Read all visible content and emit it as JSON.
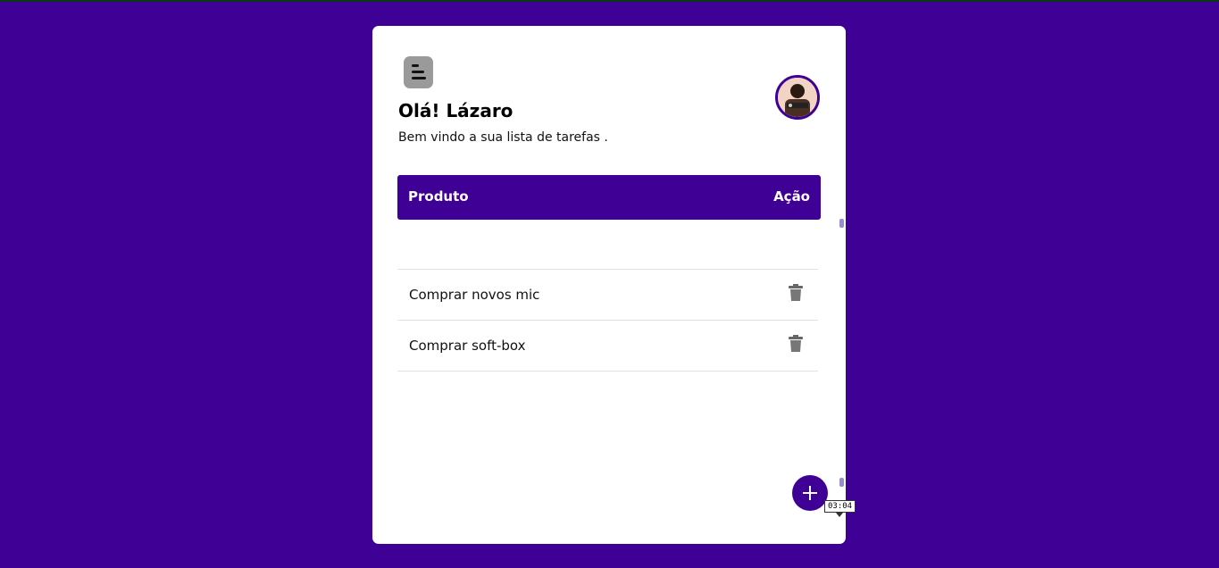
{
  "header": {
    "greeting": "Olá! Lázaro",
    "subtitle": "Bem vindo a sua lista de tarefas ."
  },
  "table": {
    "col_product": "Produto",
    "col_action": "Ação"
  },
  "tasks": [
    {
      "label": "Comprar novos mic"
    },
    {
      "label": "Comprar soft-box"
    }
  ],
  "fab": {
    "icon": "plus-icon"
  },
  "tooltip": {
    "text": "03:04"
  },
  "icons": {
    "menu": "menu-icon",
    "delete": "trash-icon"
  },
  "colors": {
    "background": "#3f0096",
    "accent": "#3f0096",
    "card": "#ffffff"
  }
}
